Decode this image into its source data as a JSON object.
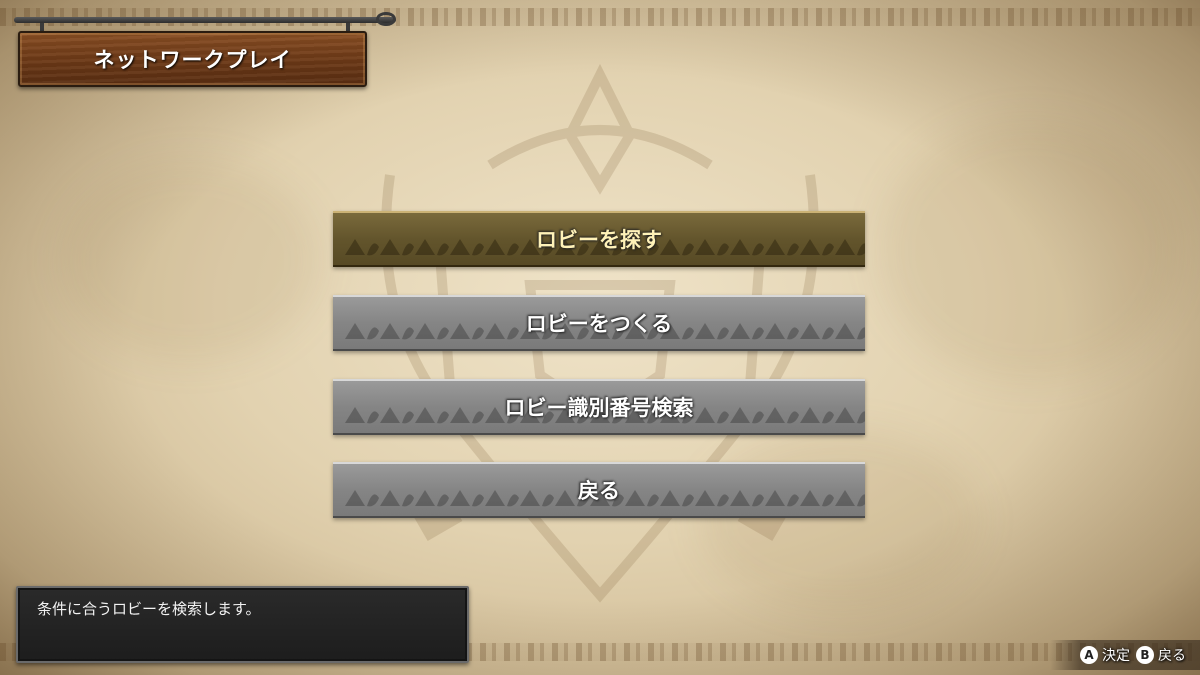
{
  "screen": {
    "title": "ネットワークプレイ"
  },
  "menu": {
    "items": [
      {
        "label": "ロビーを探す",
        "selected": true
      },
      {
        "label": "ロビーをつくる",
        "selected": false
      },
      {
        "label": "ロビー識別番号検索",
        "selected": false
      },
      {
        "label": "戻る",
        "selected": false
      }
    ]
  },
  "help": {
    "text": "条件に合うロビーを検索します。"
  },
  "hints": [
    {
      "button": "A",
      "label": "決定"
    },
    {
      "button": "B",
      "label": "戻る"
    }
  ],
  "colors": {
    "parchment": "#e2d2b0",
    "plaque_wood": "#6e3a17",
    "menu_gray": "#858585",
    "menu_selected": "#63552c",
    "selected_text": "#fff2b8"
  },
  "icons": {
    "confirm": "a-button-icon",
    "back": "b-button-icon"
  }
}
